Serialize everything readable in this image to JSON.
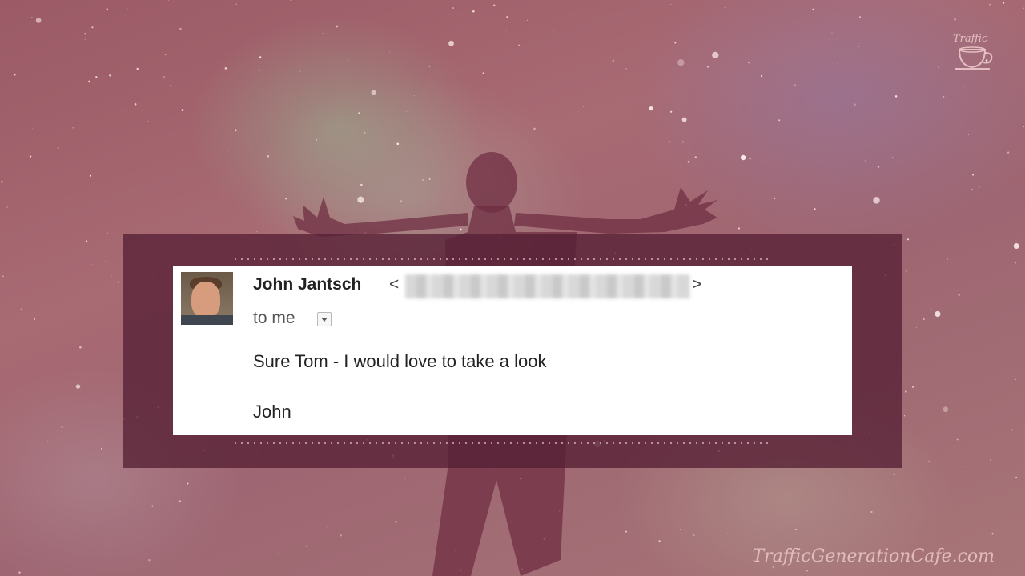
{
  "email": {
    "sender_name": "John Jantsch",
    "address_open": "<",
    "address_close": ">",
    "recipient": "to me",
    "body_lines": [
      "Sure Tom - I would love to take a look",
      "John"
    ]
  },
  "brand": {
    "watermark": "TrafficGenerationCafe.com",
    "logo_text": "Traffic"
  },
  "icons": {
    "details_toggle": "chevron-down-icon",
    "avatar": "avatar",
    "logo": "coffee-cup-icon"
  },
  "colors": {
    "background": "#9e6672",
    "frame": "#562034",
    "card": "#ffffff",
    "text": "#222222"
  }
}
